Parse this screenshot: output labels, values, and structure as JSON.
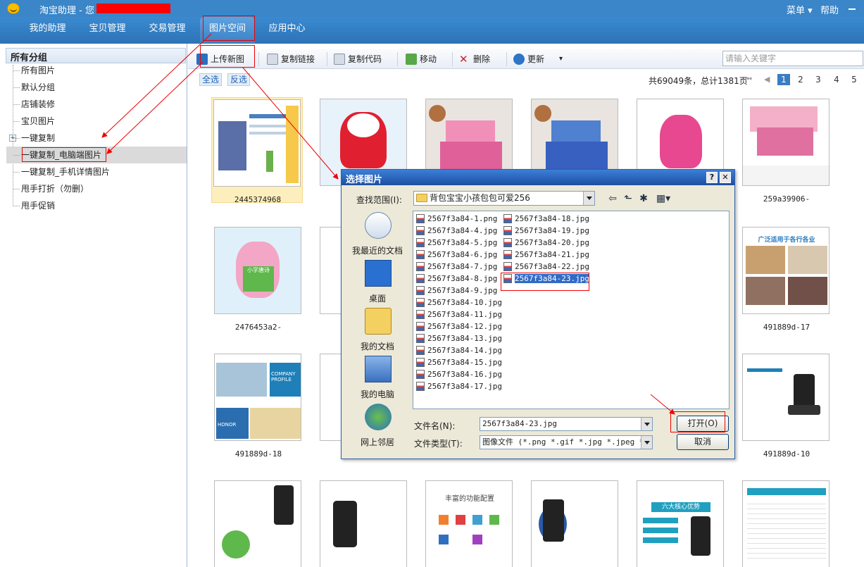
{
  "titlebar": {
    "title": "淘宝助理 - 您",
    "menu": "菜单 ▾",
    "help": "帮助"
  },
  "nav": {
    "tabs": [
      "我的助理",
      "宝贝管理",
      "交易管理",
      "图片空间",
      "应用中心"
    ],
    "active": "图片空间"
  },
  "sidebar": {
    "header": "所有分组",
    "items": [
      "所有图片",
      "默认分组",
      "店铺装修",
      "宝贝图片",
      "一键复制",
      "一键复制_电脑端图片",
      "一键复制_手机详情图片",
      "甩手打折（勿删）",
      "甩手促销"
    ],
    "expand_symbol": "+"
  },
  "toolbar": {
    "upload": "上传新图",
    "copy_link": "复制链接",
    "copy_code": "复制代码",
    "move": "移动",
    "delete": "删除",
    "update": "更新",
    "dropdown": "▾",
    "search_placeholder": "请输入关键字"
  },
  "selection": {
    "select_all": "全选",
    "invert": "反选"
  },
  "pagination": {
    "total": "共69049条，总计1381页",
    "first": "⏮",
    "prev": "◀",
    "pages": [
      "1",
      "2",
      "3",
      "4",
      "5"
    ],
    "current": "1"
  },
  "grid": {
    "labels": [
      "2445374968",
      "",
      "",
      "",
      "",
      "259a39906-",
      "2476453a2-",
      "",
      "",
      "",
      "",
      "491889d-17",
      "491889d-18",
      "",
      "",
      "",
      "",
      "491889d-10",
      "",
      "",
      "",
      "",
      "",
      ""
    ],
    "captions": {
      "p1": "丰富的功能配置",
      "p2": "六大核心优势",
      "p3": "广泛适用于各行各业",
      "p4": "COMPANY PROFILE",
      "p5": "HONOR",
      "p6": "小学唐诗"
    }
  },
  "dialog": {
    "title": "选择图片",
    "help_button": "?",
    "close_button": "✕",
    "lookin_label": "查找范围(I):",
    "lookin_value": "背包宝宝小孩包包可爱256",
    "places": [
      "我最近的文档",
      "桌面",
      "我的文档",
      "我的电脑",
      "网上邻居"
    ],
    "files_col1": [
      "2567f3a84-1.png",
      "2567f3a84-4.jpg",
      "2567f3a84-5.jpg",
      "2567f3a84-6.jpg",
      "2567f3a84-7.jpg",
      "2567f3a84-8.jpg",
      "2567f3a84-9.jpg",
      "2567f3a84-10.jpg",
      "2567f3a84-11.jpg",
      "2567f3a84-12.jpg",
      "2567f3a84-13.jpg",
      "2567f3a84-14.jpg",
      "2567f3a84-15.jpg",
      "2567f3a84-16.jpg",
      "2567f3a84-17.jpg"
    ],
    "files_col2": [
      "2567f3a84-18.jpg",
      "2567f3a84-19.jpg",
      "2567f3a84-20.jpg",
      "2567f3a84-21.jpg",
      "2567f3a84-22.jpg",
      "2567f3a84-23.jpg"
    ],
    "selected_file": "2567f3a84-23.jpg",
    "filename_label": "文件名(N):",
    "filename_value": "2567f3a84-23.jpg",
    "filetype_label": "文件类型(T):",
    "filetype_value": "图像文件 (*.png *.gif *.jpg *.jpeg *.",
    "open_button": "打开(O)",
    "cancel_button": "取消"
  },
  "colors": {
    "titlebar": "#3a86c8",
    "annotation": "#e00000",
    "selection": "#316ac5",
    "dialog_face": "#ece9d8"
  }
}
